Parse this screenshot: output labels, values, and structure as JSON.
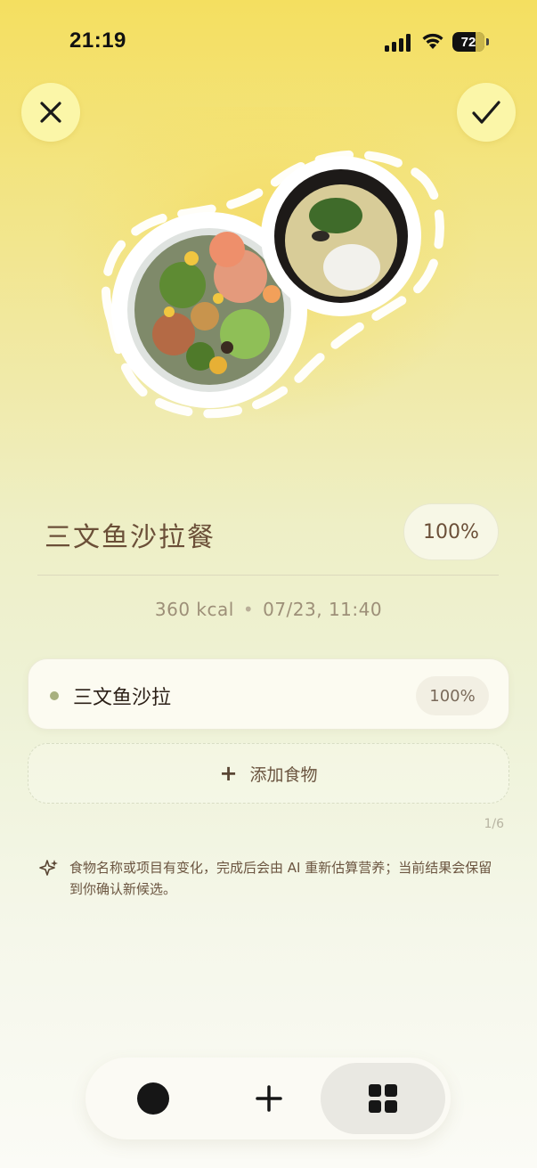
{
  "status_bar": {
    "time": "21:19",
    "battery": "72"
  },
  "header": {
    "close_icon": "close-icon",
    "confirm_icon": "checkmark-icon"
  },
  "meal": {
    "name": "三文鱼沙拉餐",
    "portion": "100%",
    "calories": "360 kcal",
    "separator": "•",
    "datetime": "07/23, 11:40"
  },
  "items": [
    {
      "name": "三文鱼沙拉",
      "portion": "100%"
    }
  ],
  "add_food": {
    "icon": "plus-icon",
    "label": "添加食物"
  },
  "counter": "1/6",
  "note": {
    "icon": "sparkle-icon",
    "text": "食物名称或项目有变化，完成后会由 AI 重新估算营养；当前结果会保留到你确认新候选。"
  },
  "bottom_nav": {
    "items": [
      {
        "icon": "circle-dot-icon"
      },
      {
        "icon": "plus-icon"
      },
      {
        "icon": "grid-icon",
        "selected": true
      }
    ]
  },
  "colors": {
    "accent_yellow": "#fbf6a8",
    "text_brown": "#6b4f38",
    "item_dot": "#a8b07f"
  }
}
